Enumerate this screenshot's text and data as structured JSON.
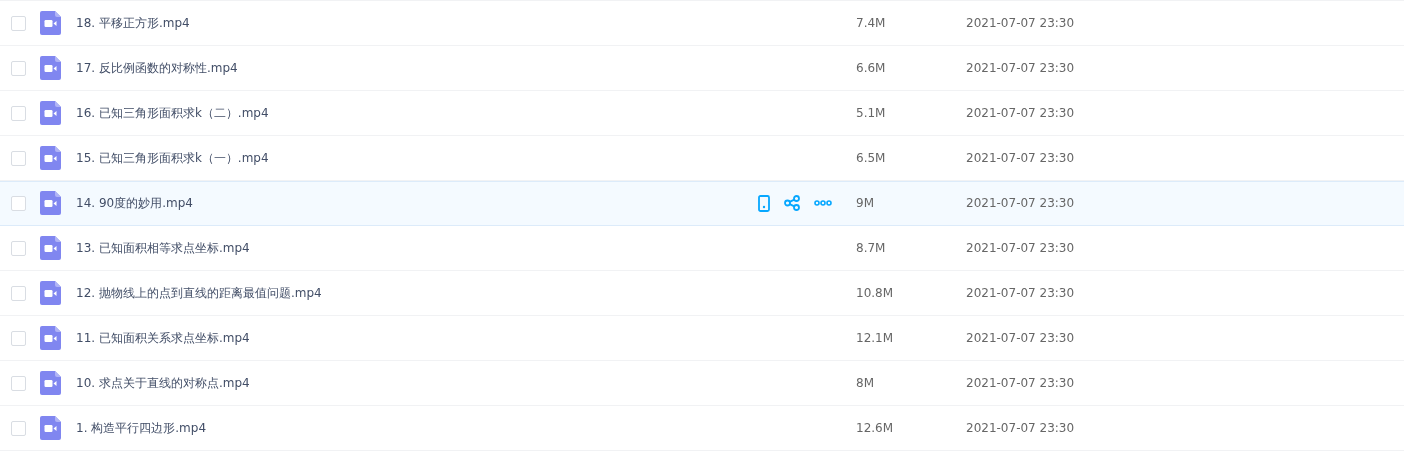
{
  "files": [
    {
      "name": "18. 平移正方形.mp4",
      "size": "7.4M",
      "modified": "2021-07-07 23:30",
      "checked": false,
      "hovered": false
    },
    {
      "name": "17. 反比例函数的对称性.mp4",
      "size": "6.6M",
      "modified": "2021-07-07 23:30",
      "checked": false,
      "hovered": false
    },
    {
      "name": "16. 已知三角形面积求k（二）.mp4",
      "size": "5.1M",
      "modified": "2021-07-07 23:30",
      "checked": false,
      "hovered": false
    },
    {
      "name": "15. 已知三角形面积求k（一）.mp4",
      "size": "6.5M",
      "modified": "2021-07-07 23:30",
      "checked": false,
      "hovered": false
    },
    {
      "name": "14. 90度的妙用.mp4",
      "size": "9M",
      "modified": "2021-07-07 23:30",
      "checked": false,
      "hovered": true
    },
    {
      "name": "13. 已知面积相等求点坐标.mp4",
      "size": "8.7M",
      "modified": "2021-07-07 23:30",
      "checked": false,
      "hovered": false
    },
    {
      "name": "12. 抛物线上的点到直线的距离最值问题.mp4",
      "size": "10.8M",
      "modified": "2021-07-07 23:30",
      "checked": false,
      "hovered": false
    },
    {
      "name": "11. 已知面积关系求点坐标.mp4",
      "size": "12.1M",
      "modified": "2021-07-07 23:30",
      "checked": false,
      "hovered": false
    },
    {
      "name": "10. 求点关于直线的对称点.mp4",
      "size": "8M",
      "modified": "2021-07-07 23:30",
      "checked": false,
      "hovered": false
    },
    {
      "name": "1. 构造平行四边形.mp4",
      "size": "12.6M",
      "modified": "2021-07-07 23:30",
      "checked": false,
      "hovered": false
    }
  ]
}
